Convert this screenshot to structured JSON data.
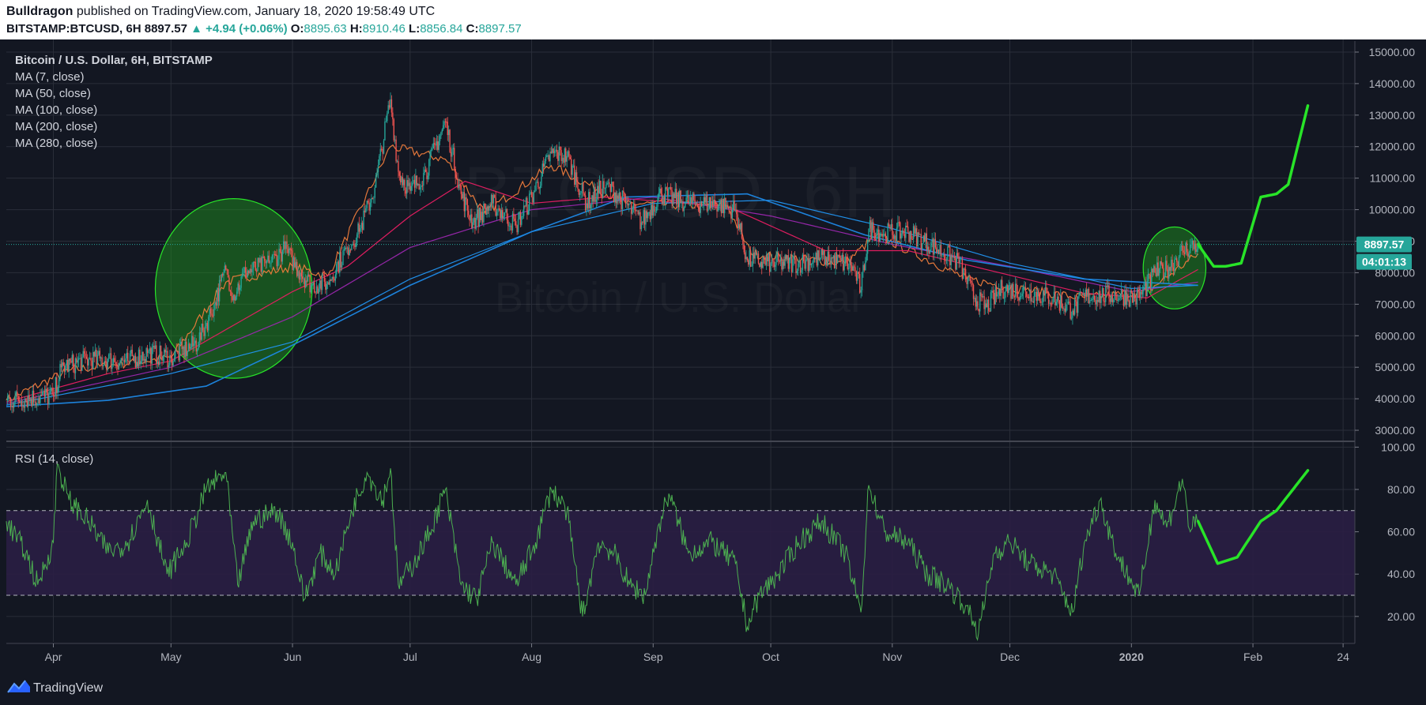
{
  "header": {
    "author": "Bulldragon",
    "published_text": "published on TradingView.com, January 18, 2020 19:58:49 UTC",
    "symbol": "BITSTAMP:BTCUSD, 6H",
    "last": "8897.57",
    "change": "▲ +4.94 (+0.06%)",
    "o_label": "O:",
    "o_value": "8895.63",
    "h_label": "H:",
    "h_value": "8910.46",
    "l_label": "L:",
    "l_value": "8856.84",
    "c_label": "C:",
    "c_value": "8897.57"
  },
  "price_pane": {
    "legend": [
      "Bitcoin / U.S. Dollar, 6H, BITSTAMP",
      "MA (7, close)",
      "MA (50, close)",
      "MA (100, close)",
      "MA (200, close)",
      "MA (280, close)"
    ],
    "watermark_symbol": "BTCUSD, 6H",
    "watermark_name": "Bitcoin / U.S. Dollar",
    "price_ticks": [
      "15000.00",
      "14000.00",
      "13000.00",
      "12000.00",
      "11000.00",
      "10000.00",
      "9000.00",
      "8000.00",
      "7000.00",
      "6000.00",
      "5000.00",
      "4000.00",
      "3000.00"
    ],
    "last_price_badge": "8897.57",
    "countdown_badge": "04:01:13"
  },
  "rsi_pane": {
    "legend": "RSI (14, close)",
    "ticks": [
      "100.00",
      "80.00",
      "60.00",
      "40.00",
      "20.00"
    ]
  },
  "time_axis": [
    "Apr",
    "May",
    "Jun",
    "Jul",
    "Aug",
    "Sep",
    "Oct",
    "Nov",
    "Dec",
    "2020",
    "Feb",
    "24"
  ],
  "footer": {
    "brand": "TradingView"
  },
  "colors": {
    "background": "#131722",
    "grid": "#2a2e39",
    "candle_up": "#26a69a",
    "candle_down": "#ef5350",
    "ma7": "#ef7c3c",
    "ma50": "#e91e63",
    "ma100": "#9c27b0",
    "ma200": "#2196f3",
    "highlight": "#28e428",
    "rsi_line": "#4caf50",
    "rsi_band": "#2a1e44"
  },
  "chart_data": {
    "type": "line",
    "series_kind": "candlestick",
    "interval": "6H",
    "ylim": [
      2700,
      15300
    ],
    "rsi_ylim": [
      8,
      102
    ],
    "rsi_bands": [
      30,
      70
    ],
    "price_path": [
      [
        "2019-03-20",
        3950
      ],
      [
        "2019-04-01",
        4100
      ],
      [
        "2019-04-03",
        5000
      ],
      [
        "2019-04-10",
        5250
      ],
      [
        "2019-04-20",
        5200
      ],
      [
        "2019-04-25",
        5450
      ],
      [
        "2019-05-01",
        5300
      ],
      [
        "2019-05-08",
        5800
      ],
      [
        "2019-05-12",
        7000
      ],
      [
        "2019-05-15",
        8100
      ],
      [
        "2019-05-17",
        7300
      ],
      [
        "2019-05-20",
        8000
      ],
      [
        "2019-05-26",
        8300
      ],
      [
        "2019-05-30",
        8750
      ],
      [
        "2019-06-03",
        8000
      ],
      [
        "2019-06-06",
        7600
      ],
      [
        "2019-06-10",
        7700
      ],
      [
        "2019-06-15",
        8800
      ],
      [
        "2019-06-18",
        9300
      ],
      [
        "2019-06-22",
        10700
      ],
      [
        "2019-06-26",
        13500
      ],
      [
        "2019-06-28",
        11200
      ],
      [
        "2019-07-01",
        10600
      ],
      [
        "2019-07-05",
        11200
      ],
      [
        "2019-07-10",
        12800
      ],
      [
        "2019-07-14",
        10500
      ],
      [
        "2019-07-17",
        9600
      ],
      [
        "2019-07-22",
        10200
      ],
      [
        "2019-07-28",
        9500
      ],
      [
        "2019-08-01",
        10400
      ],
      [
        "2019-08-06",
        11800
      ],
      [
        "2019-08-10",
        11700
      ],
      [
        "2019-08-15",
        10200
      ],
      [
        "2019-08-20",
        10800
      ],
      [
        "2019-08-25",
        10200
      ],
      [
        "2019-08-29",
        9600
      ],
      [
        "2019-09-03",
        10500
      ],
      [
        "2019-09-10",
        10200
      ],
      [
        "2019-09-17",
        10200
      ],
      [
        "2019-09-22",
        10000
      ],
      [
        "2019-09-25",
        8400
      ],
      [
        "2019-10-01",
        8300
      ],
      [
        "2019-10-08",
        8300
      ],
      [
        "2019-10-15",
        8500
      ],
      [
        "2019-10-22",
        8200
      ],
      [
        "2019-10-24",
        7450
      ],
      [
        "2019-10-26",
        9400
      ],
      [
        "2019-10-30",
        9250
      ],
      [
        "2019-11-05",
        9300
      ],
      [
        "2019-11-12",
        8800
      ],
      [
        "2019-11-18",
        8300
      ],
      [
        "2019-11-22",
        7200
      ],
      [
        "2019-11-25",
        6900
      ],
      [
        "2019-11-29",
        7500
      ],
      [
        "2019-12-05",
        7400
      ],
      [
        "2019-12-12",
        7200
      ],
      [
        "2019-12-17",
        6800
      ],
      [
        "2019-12-20",
        7250
      ],
      [
        "2019-12-28",
        7300
      ],
      [
        "2020-01-03",
        7200
      ],
      [
        "2020-01-07",
        8000
      ],
      [
        "2020-01-10",
        8100
      ],
      [
        "2020-01-14",
        8700
      ],
      [
        "2020-01-18",
        8898
      ]
    ],
    "ma_path": {
      "MA (7, close)": [
        [
          "2019-03-20",
          3950
        ],
        [
          "2019-04-05",
          4900
        ],
        [
          "2019-05-01",
          5300
        ],
        [
          "2019-05-15",
          7700
        ],
        [
          "2019-06-01",
          8200
        ],
        [
          "2019-06-10",
          7900
        ],
        [
          "2019-06-26",
          12000
        ],
        [
          "2019-07-10",
          11600
        ],
        [
          "2019-07-20",
          9900
        ],
        [
          "2019-08-06",
          11400
        ],
        [
          "2019-08-25",
          10200
        ],
        [
          "2019-09-20",
          10100
        ],
        [
          "2019-09-26",
          8600
        ],
        [
          "2019-10-20",
          8300
        ],
        [
          "2019-10-28",
          9200
        ],
        [
          "2019-11-20",
          7800
        ],
        [
          "2019-12-05",
          7450
        ],
        [
          "2019-12-20",
          7200
        ],
        [
          "2020-01-05",
          7400
        ],
        [
          "2020-01-18",
          8600
        ]
      ],
      "MA (50, close)": [
        [
          "2019-03-20",
          3900
        ],
        [
          "2019-04-15",
          4800
        ],
        [
          "2019-05-01",
          5200
        ],
        [
          "2019-06-01",
          7400
        ],
        [
          "2019-06-15",
          8200
        ],
        [
          "2019-07-01",
          9800
        ],
        [
          "2019-07-15",
          10900
        ],
        [
          "2019-08-01",
          10200
        ],
        [
          "2019-08-20",
          10400
        ],
        [
          "2019-09-20",
          10100
        ],
        [
          "2019-10-15",
          8700
        ],
        [
          "2019-11-05",
          8700
        ],
        [
          "2019-11-25",
          8100
        ],
        [
          "2019-12-20",
          7350
        ],
        [
          "2020-01-05",
          7200
        ],
        [
          "2020-01-18",
          8100
        ]
      ],
      "MA (100, close)": [
        [
          "2019-03-20",
          3850
        ],
        [
          "2019-05-01",
          5000
        ],
        [
          "2019-06-01",
          6600
        ],
        [
          "2019-07-01",
          8800
        ],
        [
          "2019-08-01",
          10000
        ],
        [
          "2019-09-01",
          10400
        ],
        [
          "2019-10-01",
          9800
        ],
        [
          "2019-11-01",
          8900
        ],
        [
          "2019-12-01",
          8200
        ],
        [
          "2020-01-01",
          7400
        ],
        [
          "2020-01-18",
          7700
        ]
      ],
      "MA (200, close)": [
        [
          "2019-03-20",
          3800
        ],
        [
          "2019-05-01",
          4800
        ],
        [
          "2019-06-01",
          5800
        ],
        [
          "2019-07-01",
          7800
        ],
        [
          "2019-08-01",
          9300
        ],
        [
          "2019-09-01",
          10200
        ],
        [
          "2019-10-01",
          10300
        ],
        [
          "2019-11-01",
          9400
        ],
        [
          "2019-12-01",
          8300
        ],
        [
          "2020-01-01",
          7500
        ],
        [
          "2020-01-18",
          7600
        ]
      ],
      "MA (280, close)": [
        [
          "2019-03-20",
          3750
        ],
        [
          "2019-04-15",
          3950
        ],
        [
          "2019-05-10",
          4400
        ],
        [
          "2019-06-01",
          5700
        ],
        [
          "2019-07-01",
          7600
        ],
        [
          "2019-08-01",
          9300
        ],
        [
          "2019-08-25",
          10400
        ],
        [
          "2019-09-25",
          10500
        ],
        [
          "2019-10-25",
          9200
        ],
        [
          "2019-11-20",
          8400
        ],
        [
          "2019-12-20",
          7800
        ],
        [
          "2020-01-18",
          7600
        ]
      ]
    },
    "rsi_path": [
      [
        "2019-03-20",
        65
      ],
      [
        "2019-03-25",
        50
      ],
      [
        "2019-03-28",
        35
      ],
      [
        "2019-04-01",
        55
      ],
      [
        "2019-04-02",
        92
      ],
      [
        "2019-04-05",
        75
      ],
      [
        "2019-04-10",
        65
      ],
      [
        "2019-04-15",
        50
      ],
      [
        "2019-04-20",
        55
      ],
      [
        "2019-04-25",
        75
      ],
      [
        "2019-04-30",
        40
      ],
      [
        "2019-05-05",
        55
      ],
      [
        "2019-05-10",
        80
      ],
      [
        "2019-05-15",
        88
      ],
      [
        "2019-05-18",
        35
      ],
      [
        "2019-05-22",
        65
      ],
      [
        "2019-05-28",
        70
      ],
      [
        "2019-06-01",
        55
      ],
      [
        "2019-06-04",
        28
      ],
      [
        "2019-06-08",
        50
      ],
      [
        "2019-06-12",
        40
      ],
      [
        "2019-06-16",
        70
      ],
      [
        "2019-06-20",
        88
      ],
      [
        "2019-06-24",
        75
      ],
      [
        "2019-06-26",
        90
      ],
      [
        "2019-06-28",
        35
      ],
      [
        "2019-07-02",
        45
      ],
      [
        "2019-07-06",
        60
      ],
      [
        "2019-07-10",
        80
      ],
      [
        "2019-07-14",
        35
      ],
      [
        "2019-07-18",
        28
      ],
      [
        "2019-07-22",
        55
      ],
      [
        "2019-07-28",
        35
      ],
      [
        "2019-08-02",
        55
      ],
      [
        "2019-08-06",
        80
      ],
      [
        "2019-08-10",
        70
      ],
      [
        "2019-08-14",
        20
      ],
      [
        "2019-08-18",
        55
      ],
      [
        "2019-08-22",
        50
      ],
      [
        "2019-08-26",
        35
      ],
      [
        "2019-08-30",
        30
      ],
      [
        "2019-09-02",
        60
      ],
      [
        "2019-09-05",
        78
      ],
      [
        "2019-09-10",
        50
      ],
      [
        "2019-09-16",
        55
      ],
      [
        "2019-09-22",
        45
      ],
      [
        "2019-09-25",
        15
      ],
      [
        "2019-09-28",
        30
      ],
      [
        "2019-10-03",
        40
      ],
      [
        "2019-10-08",
        55
      ],
      [
        "2019-10-14",
        65
      ],
      [
        "2019-10-20",
        50
      ],
      [
        "2019-10-24",
        22
      ],
      [
        "2019-10-26",
        82
      ],
      [
        "2019-10-30",
        60
      ],
      [
        "2019-11-05",
        55
      ],
      [
        "2019-11-10",
        40
      ],
      [
        "2019-11-15",
        35
      ],
      [
        "2019-11-20",
        25
      ],
      [
        "2019-11-23",
        12
      ],
      [
        "2019-11-27",
        50
      ],
      [
        "2019-12-01",
        55
      ],
      [
        "2019-12-06",
        45
      ],
      [
        "2019-12-12",
        40
      ],
      [
        "2019-12-17",
        22
      ],
      [
        "2019-12-20",
        55
      ],
      [
        "2019-12-24",
        75
      ],
      [
        "2019-12-28",
        50
      ],
      [
        "2020-01-03",
        30
      ],
      [
        "2020-01-07",
        75
      ],
      [
        "2020-01-10",
        62
      ],
      [
        "2020-01-14",
        85
      ],
      [
        "2020-01-16",
        60
      ],
      [
        "2020-01-18",
        65
      ]
    ],
    "projection_price": [
      [
        "2020-01-18",
        8898
      ],
      [
        "2020-01-22",
        8200
      ],
      [
        "2020-01-25",
        8200
      ],
      [
        "2020-01-29",
        8300
      ],
      [
        "2020-02-03",
        10400
      ],
      [
        "2020-02-07",
        10500
      ],
      [
        "2020-02-10",
        10800
      ],
      [
        "2020-02-15",
        13300
      ]
    ],
    "projection_rsi": [
      [
        "2020-01-18",
        65
      ],
      [
        "2020-01-23",
        45
      ],
      [
        "2020-01-28",
        48
      ],
      [
        "2020-02-03",
        65
      ],
      [
        "2020-02-07",
        70
      ],
      [
        "2020-02-15",
        89
      ]
    ],
    "highlight_ellipses": [
      {
        "x_center": "2019-05-17",
        "y_center": 7500,
        "x_radius_days": 20,
        "y_radius": 2850
      },
      {
        "x_center": "2020-01-12",
        "y_center": 8150,
        "x_radius_days": 8,
        "y_radius": 1300
      }
    ]
  }
}
